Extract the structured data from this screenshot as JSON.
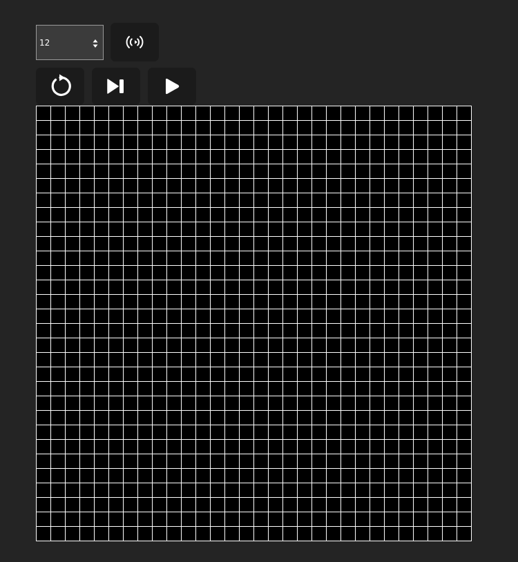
{
  "controls": {
    "speed_input": {
      "value": "12"
    },
    "broadcast_button": {
      "icon": "broadcast-icon"
    },
    "reset_button": {
      "icon": "reset-icon"
    },
    "step_button": {
      "icon": "step-forward-icon"
    },
    "play_button": {
      "icon": "play-icon"
    }
  },
  "board": {
    "rows": 30,
    "cols": 30,
    "cell_color": "#000000",
    "line_color": "#ffffff"
  },
  "colors": {
    "background": "#242424",
    "button": "#1b1b1b",
    "icon": "#ffffff"
  }
}
